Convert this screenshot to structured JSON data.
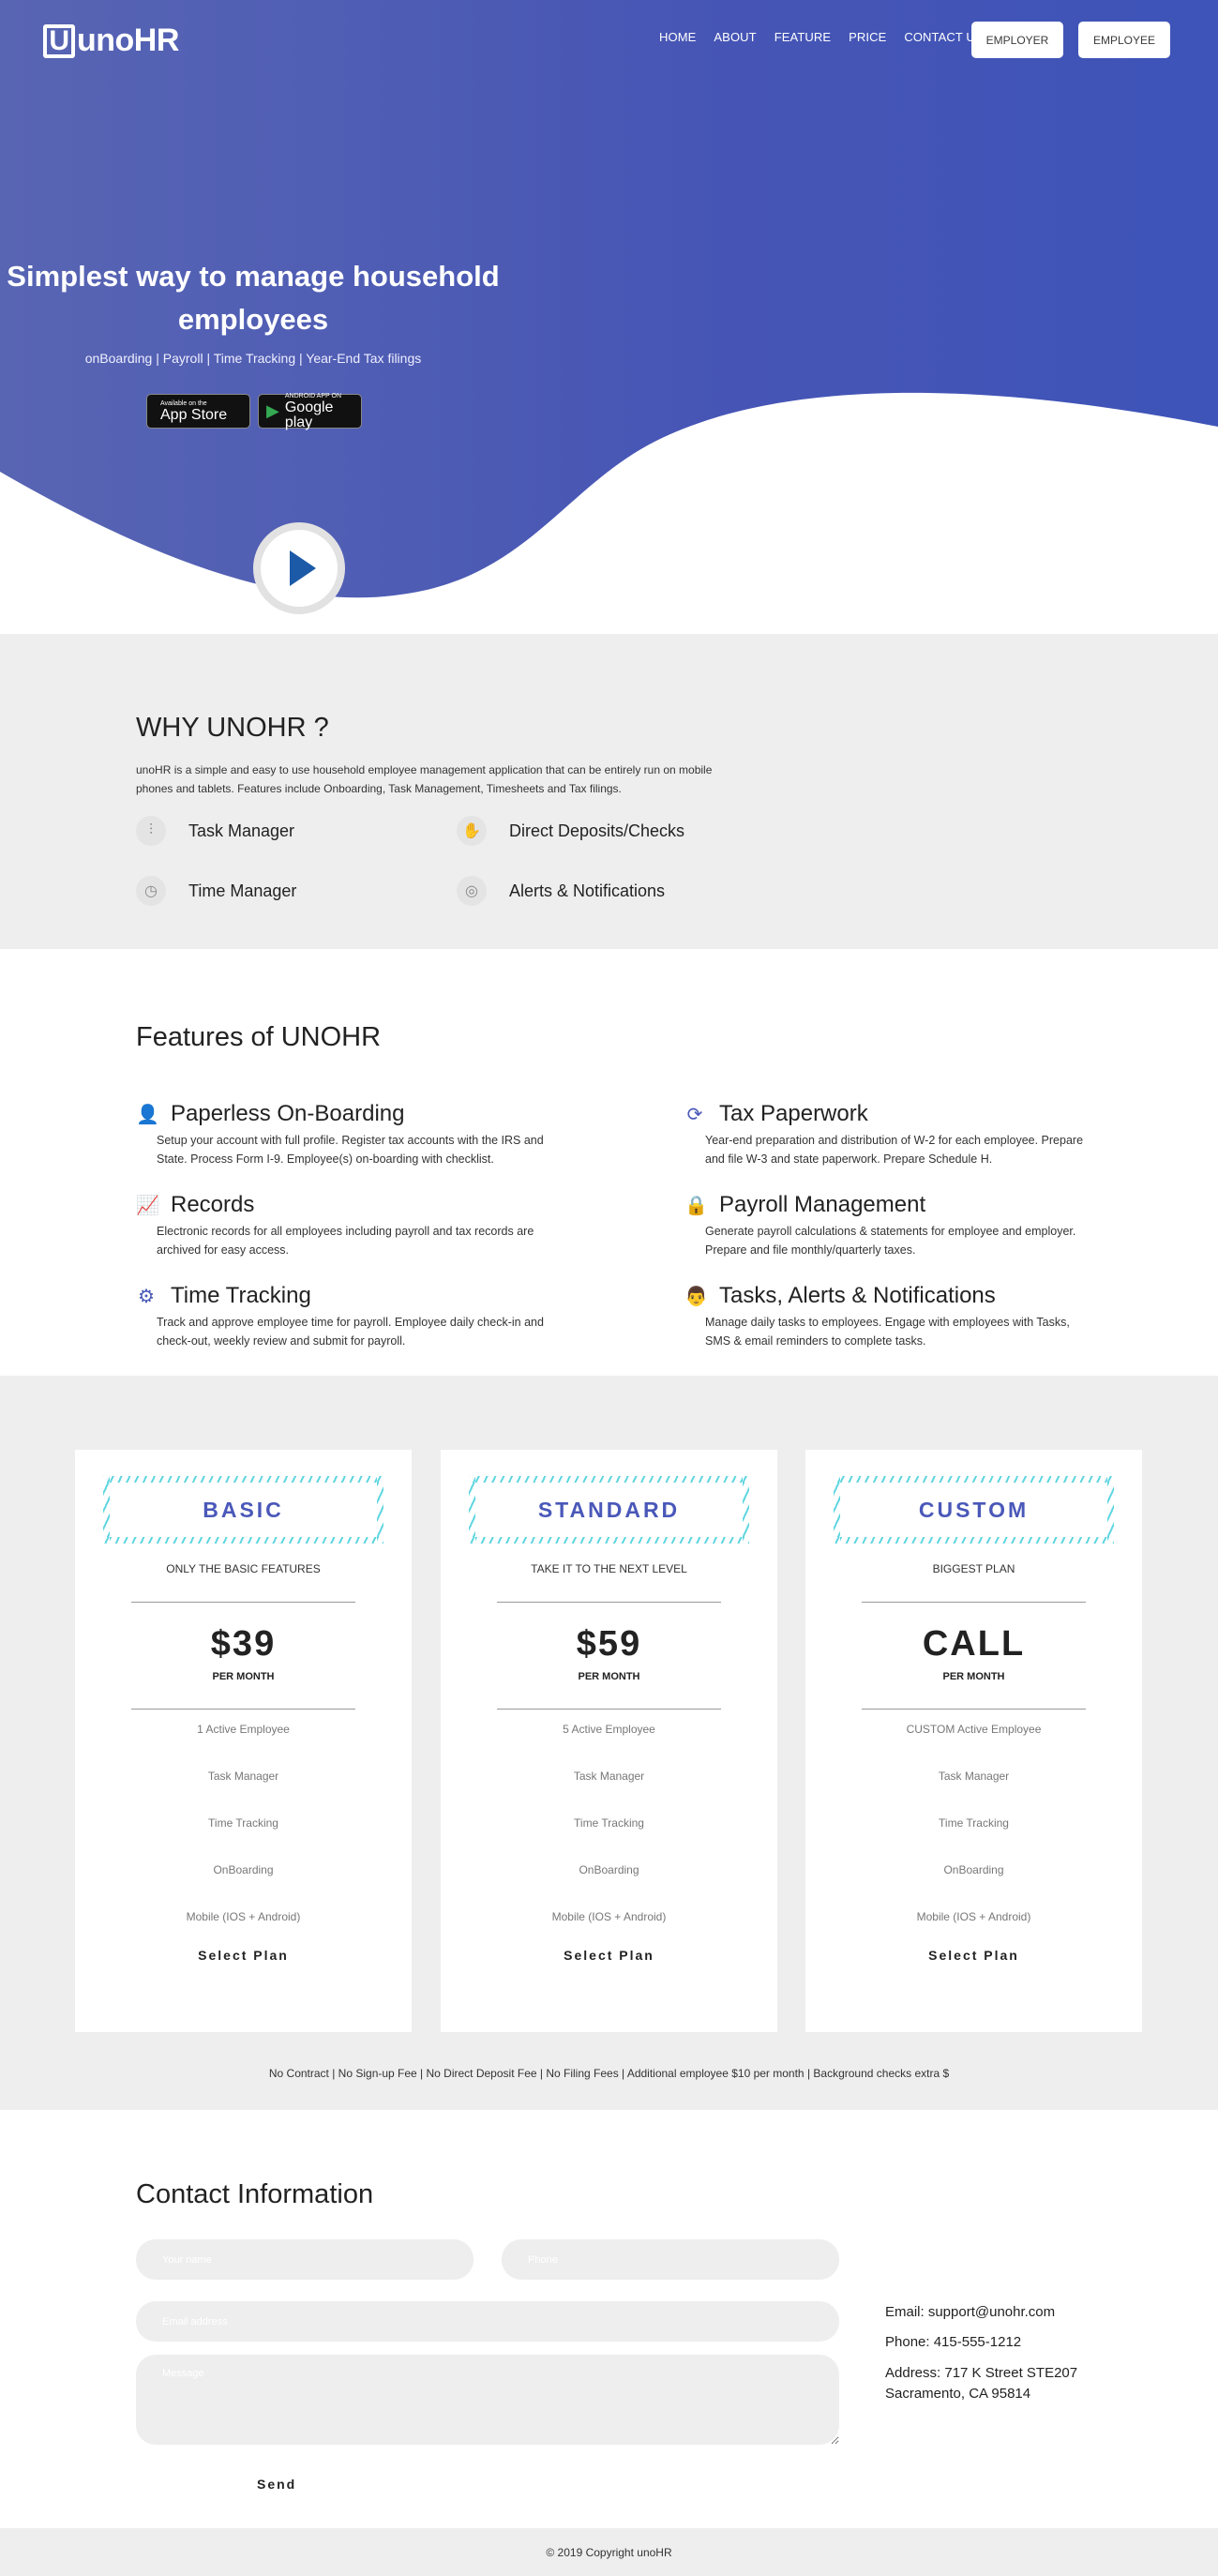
{
  "header": {
    "logo_text": "unoHR",
    "nav": [
      "HOME",
      "ABOUT",
      "FEATURE",
      "PRICE",
      "CONTACT US"
    ],
    "employer_button": "EMPLOYER",
    "employee_button": "EMPLOYEE"
  },
  "hero": {
    "title": "Simplest way to manage household employees",
    "subtitle": "onBoarding | Payroll | Time Tracking | Year-End Tax filings",
    "app_store": {
      "small": "Available on the",
      "big": "App Store"
    },
    "google_play": {
      "small": "ANDROID APP ON",
      "big": "Google play"
    }
  },
  "why": {
    "title": "WHY UNOHR ?",
    "text": "unoHR is a simple and easy to use household employee management application that can be entirely run on mobile phones and tablets. Features include Onboarding, Task Management, Timesheets and Tax filings.",
    "items": [
      {
        "label": "Task Manager",
        "icon": "sliders-icon"
      },
      {
        "label": "Direct Deposits/Checks",
        "icon": "hand-icon"
      },
      {
        "label": "Time Manager",
        "icon": "clock-icon"
      },
      {
        "label": "Alerts & Notifications",
        "icon": "fingerprint-icon"
      }
    ]
  },
  "features": {
    "title": "Features of UNOHR",
    "items": [
      {
        "title": "Paperless On-Boarding",
        "desc": "Setup your account with full profile. Register tax accounts with the IRS and State. Process Form I-9. Employee(s) on-boarding with checklist.",
        "icon": "user-icon"
      },
      {
        "title": "Tax Paperwork",
        "desc": "Year-end preparation and distribution of W-2 for each employee. Prepare and file W-3 and state paperwork. Prepare Schedule H.",
        "icon": "refresh-icon"
      },
      {
        "title": "Records",
        "desc": "Electronic records for all employees including payroll and tax records are archived for easy access.",
        "icon": "chart-icon"
      },
      {
        "title": "Payroll Management",
        "desc": "Generate payroll calculations & statements for employee and employer. Prepare and file monthly/quarterly taxes.",
        "icon": "lock-icon"
      },
      {
        "title": "Time Tracking",
        "desc": "Track and approve employee time for payroll. Employee daily check-in and check-out, weekly review and submit for payroll.",
        "icon": "gears-icon"
      },
      {
        "title": "Tasks, Alerts & Notifications",
        "desc": "Manage daily tasks to employees. Engage with employees with Tasks, SMS & email reminders to complete tasks.",
        "icon": "support-icon"
      }
    ]
  },
  "pricing": {
    "plans": [
      {
        "name": "BASIC",
        "tagline": "ONLY THE BASIC FEATURES",
        "price": "$39",
        "per": "PER MONTH",
        "features": [
          "1 Active Employee",
          "Task Manager",
          "Time Tracking",
          "OnBoarding",
          "Mobile (IOS + Android)"
        ],
        "cta": "Select Plan"
      },
      {
        "name": "STANDARD",
        "tagline": "TAKE IT TO THE NEXT LEVEL",
        "price": "$59",
        "per": "PER MONTH",
        "features": [
          "5 Active Employee",
          "Task Manager",
          "Time Tracking",
          "OnBoarding",
          "Mobile (IOS + Android)"
        ],
        "cta": "Select Plan"
      },
      {
        "name": "CUSTOM",
        "tagline": "BIGGEST PLAN",
        "price": "CALL",
        "per": "PER MONTH",
        "features": [
          "CUSTOM Active Employee",
          "Task Manager",
          "Time Tracking",
          "OnBoarding",
          "Mobile (IOS + Android)"
        ],
        "cta": "Select Plan"
      }
    ],
    "note": "No Contract | No Sign-up Fee | No Direct Deposit Fee | No Filing Fees | Additional employee $10 per month | Background checks extra $"
  },
  "contact": {
    "title": "Contact Information",
    "name_placeholder": "Your name",
    "phone_placeholder": "Phone",
    "email_placeholder": "Email address",
    "message_placeholder": "Message",
    "send": "Send",
    "email": "Email: support@unohr.com",
    "phone": "Phone: 415-555-1212",
    "address_line1": "Address: 717 K Street STE207",
    "address_line2": "Sacramento, CA 95814"
  },
  "footer": {
    "copyright": "© 2019 Copyright unoHR"
  },
  "colors": {
    "brand": "#4a58b9",
    "hero_bg": "#4655b5",
    "section_gray": "#eeeeee",
    "stripe": "#5fd6e0"
  }
}
